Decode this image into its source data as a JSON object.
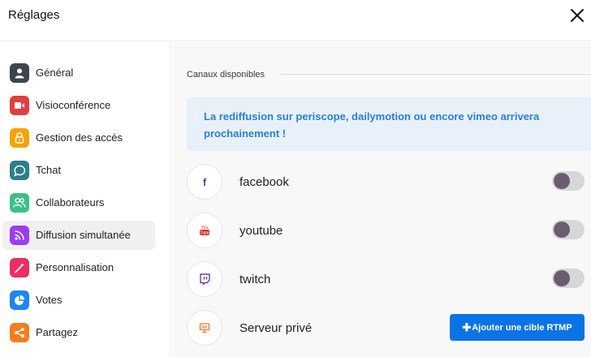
{
  "header": {
    "title": "Réglages",
    "close_icon": "close-icon"
  },
  "sidebar": {
    "items": [
      {
        "label": "Général",
        "icon": "user-icon",
        "color": "#3d4451"
      },
      {
        "label": "Visioconférence",
        "icon": "video-camera-icon",
        "color": "#e0403f"
      },
      {
        "label": "Gestion des accès",
        "icon": "lock-icon",
        "color": "#f5a300"
      },
      {
        "label": "Tchat",
        "icon": "chat-bubble-icon",
        "color": "#2e7d8c"
      },
      {
        "label": "Collaborateurs",
        "icon": "users-icon",
        "color": "#3cc08a"
      },
      {
        "label": "Diffusion simultanée",
        "icon": "broadcast-icon",
        "color": "#9b3df0"
      },
      {
        "label": "Personnalisation",
        "icon": "magic-wand-icon",
        "color": "#ea2e64"
      },
      {
        "label": "Votes",
        "icon": "pie-chart-icon",
        "color": "#1e86f0"
      },
      {
        "label": "Partagez",
        "icon": "share-icon",
        "color": "#f57c1f"
      }
    ],
    "active_index": 5
  },
  "main": {
    "section_title": "Canaux disponibles",
    "info": "La rediffusion sur periscope, dailymotion ou encore vimeo arrivera prochainement !",
    "channels": [
      {
        "label": "facebook",
        "icon": "facebook-icon",
        "enabled": false
      },
      {
        "label": "youtube",
        "icon": "youtube-icon",
        "enabled": false
      },
      {
        "label": "twitch",
        "icon": "twitch-icon",
        "enabled": false
      },
      {
        "label": "Serveur privé",
        "icon": "server-icon"
      }
    ],
    "add_button": "Ajouter une cible RTMP",
    "add_button_icon": "plus-icon"
  },
  "colors": {
    "accent": "#0b74e5",
    "info_text": "#2a7fd3",
    "info_bg": "#e8f1fa"
  }
}
